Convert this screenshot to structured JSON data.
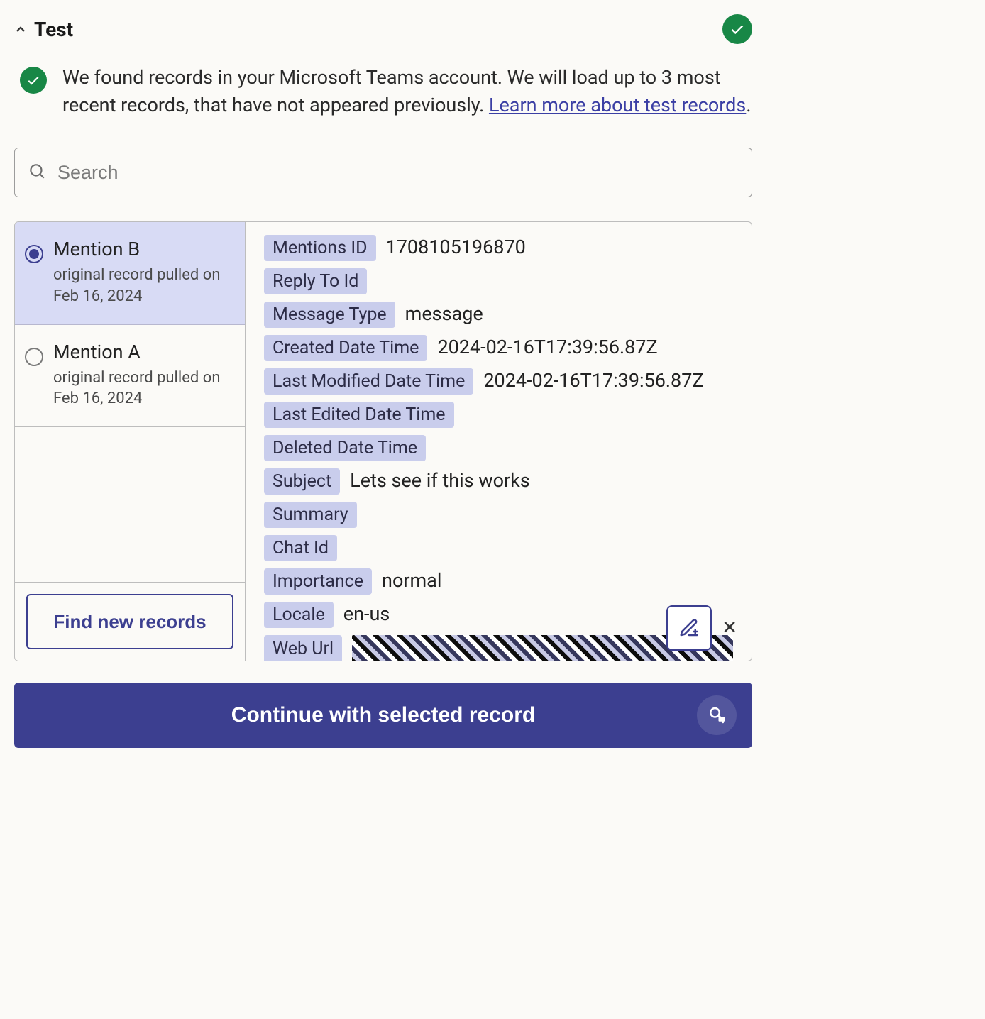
{
  "header": {
    "title": "Test"
  },
  "info": {
    "message_prefix": "We found records in your Microsoft Teams account. We will load up to 3 most recent records, that have not appeared previously. ",
    "link_text": "Learn more about test records",
    "message_suffix": "."
  },
  "search": {
    "placeholder": "Search",
    "value": ""
  },
  "records": [
    {
      "id": "mention-b",
      "title": "Mention B",
      "subtitle": "original record pulled on Feb 16, 2024",
      "selected": true
    },
    {
      "id": "mention-a",
      "title": "Mention A",
      "subtitle": "original record pulled on Feb 16, 2024",
      "selected": false
    }
  ],
  "find_new_label": "Find new records",
  "details": {
    "fields": [
      {
        "label": "Mentions ID",
        "value": "1708105196870"
      },
      {
        "label": "Reply To Id",
        "value": ""
      },
      {
        "label": "Message Type",
        "value": "message"
      },
      {
        "label": "Created Date Time",
        "value": "2024-02-16T17:39:56.87Z"
      },
      {
        "label": "Last Modified Date Time",
        "value": "2024-02-16T17:39:56.87Z"
      },
      {
        "label": "Last Edited Date Time",
        "value": ""
      },
      {
        "label": "Deleted Date Time",
        "value": ""
      },
      {
        "label": "Subject",
        "value": "Lets see if this works"
      },
      {
        "label": "Summary",
        "value": ""
      },
      {
        "label": "Chat Id",
        "value": ""
      },
      {
        "label": "Importance",
        "value": "normal"
      },
      {
        "label": "Locale",
        "value": "en-us"
      },
      {
        "label": "Web Url",
        "value": "[redacted]"
      }
    ]
  },
  "continue_label": "Continue with selected record"
}
